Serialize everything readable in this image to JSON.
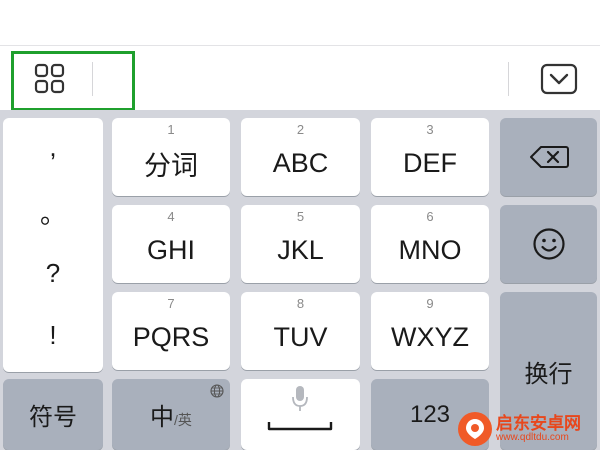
{
  "keys": {
    "r1": [
      {
        "num": "1",
        "label": "分词"
      },
      {
        "num": "2",
        "label": "ABC"
      },
      {
        "num": "3",
        "label": "DEF"
      }
    ],
    "r2": [
      {
        "num": "4",
        "label": "GHI"
      },
      {
        "num": "5",
        "label": "JKL"
      },
      {
        "num": "6",
        "label": "MNO"
      }
    ],
    "r3": [
      {
        "num": "7",
        "label": "PQRS"
      },
      {
        "num": "8",
        "label": "TUV"
      },
      {
        "num": "9",
        "label": "WXYZ"
      }
    ]
  },
  "punctuation": [
    ",",
    "。",
    "?",
    "!"
  ],
  "bottom": {
    "symbols": "符号",
    "lang_main": "中",
    "lang_alt": "/英",
    "numbers": "123",
    "enter": "换行"
  },
  "icons": {
    "toolbar_menu": "grid-icon",
    "collapse": "chevron-down-icon",
    "backspace": "backspace-icon",
    "emoji": "smile-icon",
    "mic": "microphone-icon",
    "globe": "globe-icon"
  },
  "colors": {
    "highlight": "#1fa02d",
    "keyboard_bg": "#d3d5dc",
    "function_key": "#a9b0bc",
    "watermark": "#e8471c"
  },
  "watermark": {
    "name": "启东安卓网",
    "url": "www.qdltdu.com"
  }
}
